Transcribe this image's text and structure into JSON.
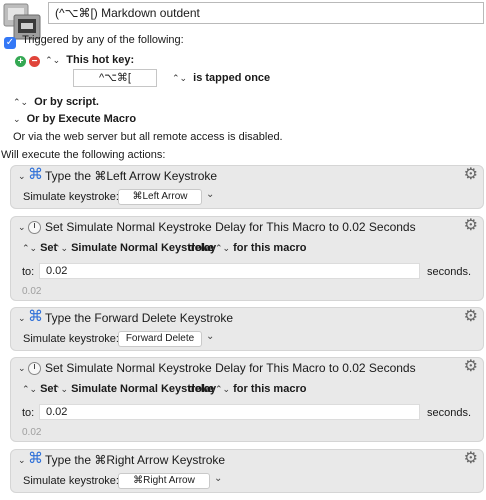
{
  "macro": {
    "name": "(^⌥⌘[) Markdown outdent"
  },
  "triggers": {
    "header": "Triggered by any of the following:",
    "hotkey_label": "This hot key:",
    "hotkey_value": "^⌥⌘[",
    "hotkey_mode": "is tapped once",
    "or_by_script": "Or by script.",
    "or_by_execute_macro": "Or by Execute Macro",
    "web_server_note": "Or via the web server but all remote access is disabled."
  },
  "actions_header": "Will execute the following actions:",
  "actions": [
    {
      "title": "Type the ⌘Left Arrow Keystroke",
      "field_label": "Simulate keystroke:",
      "keystroke": "⌘Left Arrow"
    },
    {
      "title": "Set Simulate Normal Keystroke Delay for This Macro to 0.02 Seconds",
      "set_label": "Set",
      "setting": "Simulate Normal Keystroke",
      "delay_word": "delay",
      "scope": "for this macro",
      "to_label": "to:",
      "value": "0.02",
      "unit": "seconds.",
      "computed": "0.02"
    },
    {
      "title": "Type the Forward Delete Keystroke",
      "field_label": "Simulate keystroke:",
      "keystroke": "Forward Delete"
    },
    {
      "title": "Set Simulate Normal Keystroke Delay for This Macro to 0.02 Seconds",
      "set_label": "Set",
      "setting": "Simulate Normal Keystroke",
      "delay_word": "delay",
      "scope": "for this macro",
      "to_label": "to:",
      "value": "0.02",
      "unit": "seconds.",
      "computed": "0.02"
    },
    {
      "title": "Type the ⌘Right Arrow Keystroke",
      "field_label": "Simulate keystroke:",
      "keystroke": "⌘Right Arrow"
    }
  ],
  "colors": {
    "accent": "#3478f6",
    "add_green": "#34a853",
    "remove_red": "#e0443a",
    "action_bg": "#e9e9e9"
  },
  "icons": {
    "macro": "macro-icon",
    "add": "plus-circle-icon",
    "remove": "minus-circle-icon",
    "keystroke": "command-key-icon",
    "delay": "stopwatch-icon",
    "gear": "gear-icon"
  }
}
